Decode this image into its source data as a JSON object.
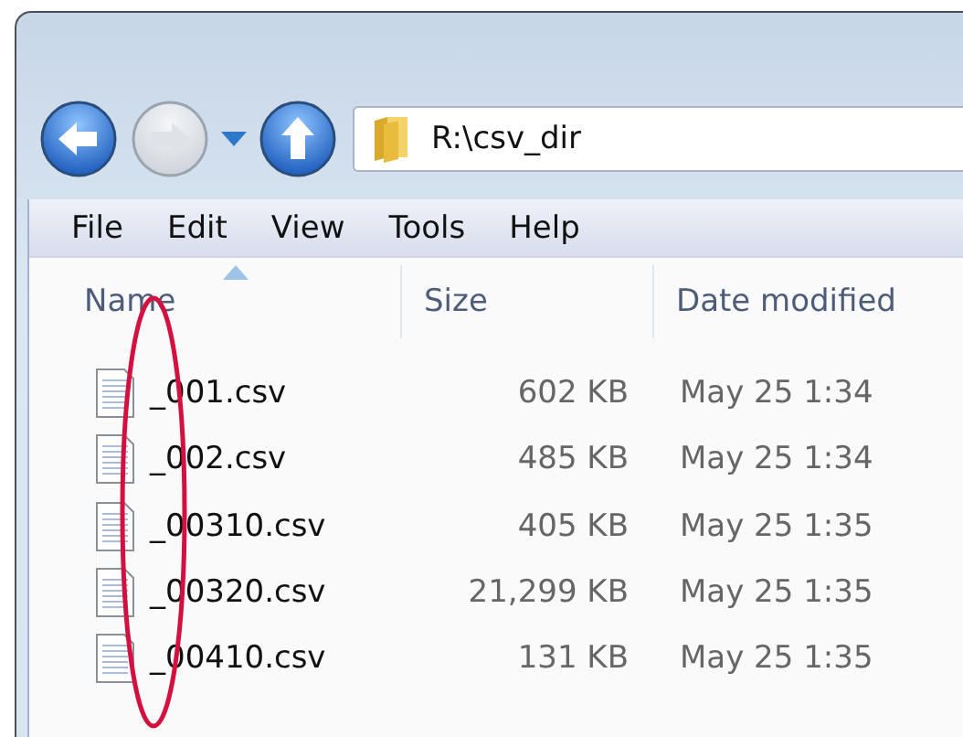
{
  "address": {
    "path": "R:\\csv_dir"
  },
  "menu": [
    "File",
    "Edit",
    "View",
    "Tools",
    "Help"
  ],
  "columns": [
    {
      "label": "Name",
      "sorted": true
    },
    {
      "label": "Size",
      "sorted": false
    },
    {
      "label": "Date modified",
      "sorted": false
    }
  ],
  "files": [
    {
      "name": "_001.csv",
      "size": "602 KB",
      "date": "May 25 1:34"
    },
    {
      "name": "_002.csv",
      "size": "485 KB",
      "date": "May 25 1:34"
    },
    {
      "name": "_00310.csv",
      "size": "405 KB",
      "date": "May 25 1:35"
    },
    {
      "name": "_00320.csv",
      "size": "21,299 KB",
      "date": "May 25 1:35"
    },
    {
      "name": "_00410.csv",
      "size": "131 KB",
      "date": "May 25 1:35"
    }
  ]
}
